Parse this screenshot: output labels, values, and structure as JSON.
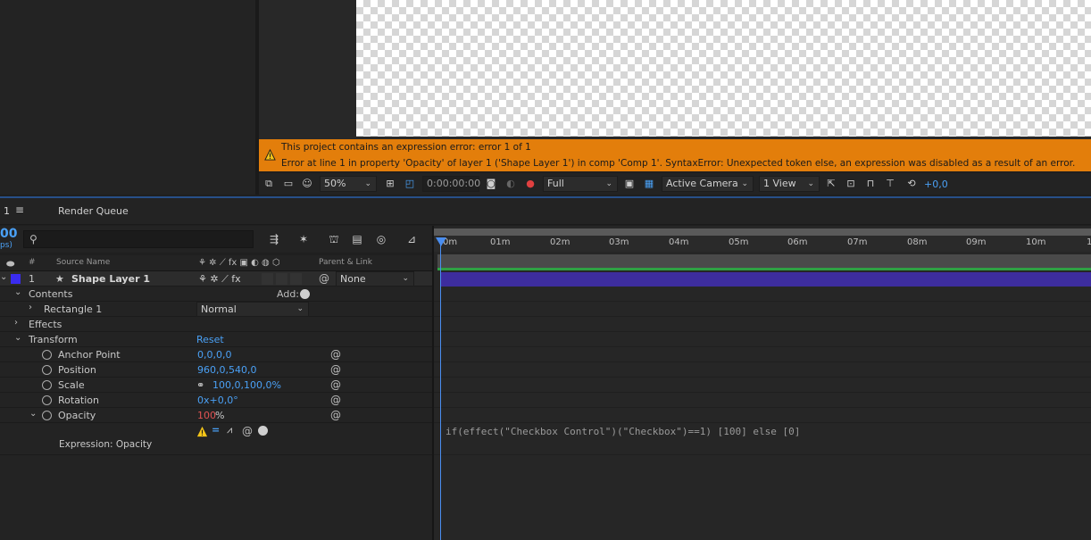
{
  "error": {
    "line1": "This project contains an expression error: error 1 of 1",
    "line2": "Error at line 1 in property 'Opacity' of layer 1 ('Shape Layer 1') in comp 'Comp 1'.  SyntaxError: Unexpected token else, an expression was disabled as a result of an error."
  },
  "viewer_toolbar": {
    "zoom": "50%",
    "timecode": "0:00:00:00",
    "resolution": "Full",
    "camera": "Active Camera",
    "views": "1 View",
    "exposure": "+0,0"
  },
  "tabs": {
    "comp_number": "1",
    "render_queue": "Render Queue"
  },
  "timeline_panel": {
    "fps_top": "00",
    "fps_bottom": "ps)"
  },
  "columns": {
    "number": "#",
    "source_name": "Source Name",
    "parent_link": "Parent & Link"
  },
  "layer": {
    "number": "1",
    "name": "Shape Layer 1",
    "color": "#3a2cf0",
    "parent": "None"
  },
  "rows": {
    "contents": "Contents",
    "add_label": "Add:",
    "rectangle": "Rectangle 1",
    "blend_mode": "Normal",
    "effects": "Effects",
    "transform": "Transform",
    "reset": "Reset",
    "anchor_label": "Anchor Point",
    "anchor_value": "0,0,0,0",
    "position_label": "Position",
    "position_value": "960,0,540,0",
    "scale_label": "Scale",
    "scale_value": "100,0,100,0%",
    "rotation_label": "Rotation",
    "rotation_value": "0x+0,0°",
    "opacity_label": "Opacity",
    "opacity_value": "100",
    "opacity_unit": "%",
    "expression_label": "Expression: Opacity"
  },
  "ruler": [
    "0m",
    "01m",
    "02m",
    "03m",
    "04m",
    "05m",
    "06m",
    "07m",
    "08m",
    "09m",
    "10m",
    "1"
  ],
  "expression_code": "if(effect(\"Checkbox Control\")(\"Checkbox\")==1) [100] else [0]",
  "colors": {
    "error_bar": "#e37e0b",
    "accent_blue": "#4aa0f5",
    "layer_bar": "#3d2d9e",
    "work_area_green": "#2ea043"
  }
}
